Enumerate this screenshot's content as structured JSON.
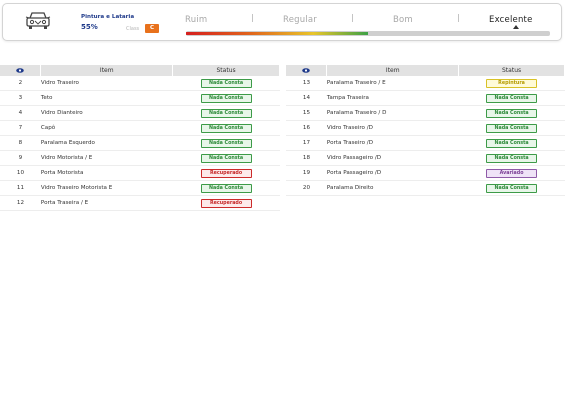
{
  "header": {
    "section_title": "Pintura e Lataria",
    "percent": "55%",
    "class_label": "Class",
    "class_value": "C",
    "rating_scale": [
      "Ruim",
      "Regular",
      "Bom",
      "Excelente"
    ],
    "rating_current": "Excelente",
    "rating_fill_fraction": 0.5,
    "car_icon": "car-front-icon"
  },
  "tables": [
    {
      "columns": {
        "icon": "eye-icon",
        "item": "Item",
        "status": "Status"
      },
      "rows": [
        {
          "num": "2",
          "item": "Vidro Traseiro",
          "status": "Nada Consta",
          "kind": "ok"
        },
        {
          "num": "3",
          "item": "Teto",
          "status": "Nada Consta",
          "kind": "ok"
        },
        {
          "num": "4",
          "item": "Vidro Dianteiro",
          "status": "Nada Consta",
          "kind": "ok"
        },
        {
          "num": "7",
          "item": "Capô",
          "status": "Nada Consta",
          "kind": "ok"
        },
        {
          "num": "8",
          "item": "Paralama Esquerdo",
          "status": "Nada Consta",
          "kind": "ok"
        },
        {
          "num": "9",
          "item": "Vidro Motorista / E",
          "status": "Nada Consta",
          "kind": "ok"
        },
        {
          "num": "10",
          "item": "Porta Motorista",
          "status": "Recuperado",
          "kind": "rec"
        },
        {
          "num": "11",
          "item": "Vidro Traseiro Motorista E",
          "status": "Nada Consta",
          "kind": "ok"
        },
        {
          "num": "12",
          "item": "Porta Traseira / E",
          "status": "Recuperado",
          "kind": "rec"
        }
      ]
    },
    {
      "columns": {
        "icon": "eye-icon",
        "item": "Item",
        "status": "Status"
      },
      "rows": [
        {
          "num": "13",
          "item": "Paralama Traseiro / E",
          "status": "Repintura",
          "kind": "rep"
        },
        {
          "num": "14",
          "item": "Tampa Traseira",
          "status": "Nada Consta",
          "kind": "ok"
        },
        {
          "num": "15",
          "item": "Paralama Traseiro / D",
          "status": "Nada Consta",
          "kind": "ok"
        },
        {
          "num": "16",
          "item": "Vidro Traseiro /D",
          "status": "Nada Consta",
          "kind": "ok"
        },
        {
          "num": "17",
          "item": "Porta Traseiro /D",
          "status": "Nada Consta",
          "kind": "ok"
        },
        {
          "num": "18",
          "item": "Vidro Passageiro /D",
          "status": "Nada Consta",
          "kind": "ok"
        },
        {
          "num": "19",
          "item": "Porta Passageiro /D",
          "status": "Avariado",
          "kind": "ava"
        },
        {
          "num": "20",
          "item": "Paralama Direito",
          "status": "Nada Consta",
          "kind": "ok"
        }
      ]
    }
  ],
  "colors": {
    "brand_blue": "#1f3a8a",
    "class_badge": "#e8711c",
    "status_ok": "#2d8a39",
    "status_recuperado": "#c62828",
    "status_repintura": "#b59b00",
    "status_avariado": "#7a3f95"
  }
}
